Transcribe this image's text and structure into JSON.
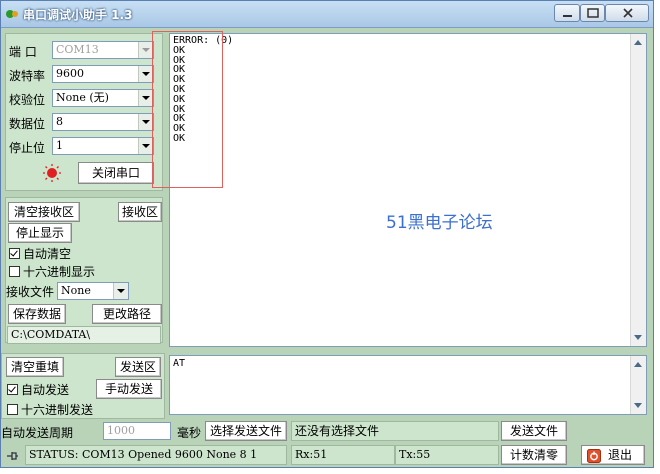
{
  "window": {
    "title": "串口调试小助手 1.3"
  },
  "settings": {
    "port_label": "端 口",
    "port_value": "COM13",
    "baud_label": "波特率",
    "baud_value": "9600",
    "parity_label": "校验位",
    "parity_value": "None (无)",
    "databits_label": "数据位",
    "databits_value": "8",
    "stopbits_label": "停止位",
    "stopbits_value": "1",
    "toggle_port_label": "关闭串口"
  },
  "receive": {
    "clear_label": "清空接收区",
    "area_label": "接收区",
    "stop_display_label": "停止显示",
    "auto_clear_label": "自动清空",
    "auto_clear_checked": true,
    "hex_display_label": "十六进制显示",
    "hex_display_checked": false,
    "file_label": "接收文件",
    "file_value": "None",
    "save_label": "保存数据",
    "change_path_label": "更改路径",
    "path_value": "C:\\COMDATA\\",
    "lines": [
      "ERROR: (0)",
      "OK",
      "OK",
      "OK",
      "OK",
      "OK",
      "OK",
      "OK",
      "OK",
      "OK",
      "OK"
    ],
    "watermark": "51黑电子论坛"
  },
  "send": {
    "clear_label": "清空重填",
    "area_label": "发送区",
    "auto_send_label": "自动发送",
    "auto_send_checked": true,
    "manual_send_label": "手动发送",
    "hex_send_label": "十六进制发送",
    "hex_send_checked": false,
    "text": "AT",
    "period_label": "自动发送周期",
    "period_value": "1000",
    "ms_label": "毫秒",
    "choose_file_label": "选择发送文件",
    "file_status": "还没有选择文件",
    "send_file_label": "发送文件",
    "count_clear_label": "计数清零",
    "exit_label": "退出"
  },
  "status": {
    "text": "STATUS: COM13 Opened 9600 None 8 1",
    "rx": "Rx:51",
    "tx": "Tx:55"
  },
  "colors": {
    "panel_bg": "#cde5cd",
    "window_bg": "#b9d3b9",
    "watermark": "#3b6fd0",
    "highlight_box": "#e06060",
    "led": "#e02020"
  }
}
